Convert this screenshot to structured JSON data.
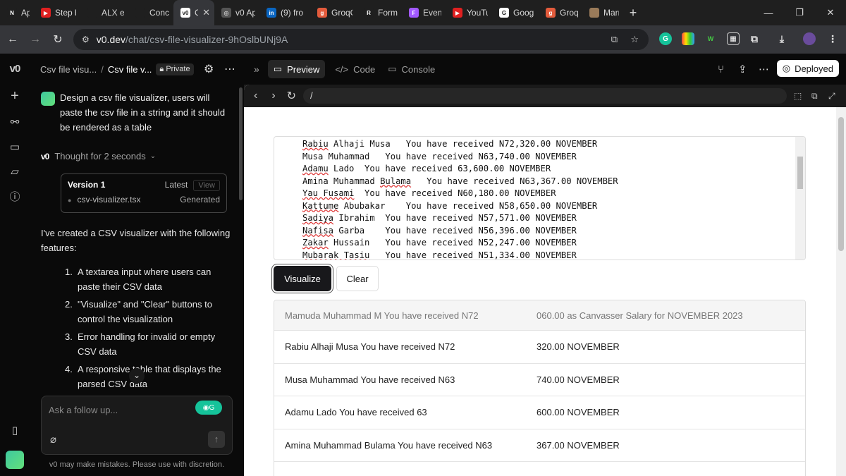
{
  "browser": {
    "tabs": [
      {
        "title": "App R",
        "fav": "N",
        "color": "#1f1f1f"
      },
      {
        "title": "Step b",
        "fav": "▶",
        "color": "#e02020"
      },
      {
        "title": "ALX e",
        "fav": "",
        "color": "#1f1f1f"
      },
      {
        "title": "Conce",
        "fav": "",
        "color": "#1f1f1f"
      },
      {
        "title": "C",
        "fav": "v0",
        "color": "#ffffff",
        "active": true
      },
      {
        "title": "v0 Ap",
        "fav": "◎",
        "color": "#555"
      },
      {
        "title": "(9) fro",
        "fav": "in",
        "color": "#0a66c2"
      },
      {
        "title": "GroqC",
        "fav": "g",
        "color": "#e35b3c"
      },
      {
        "title": "Form",
        "fav": "R",
        "color": "#1f1f1f"
      },
      {
        "title": "Event",
        "fav": "F",
        "color": "#a259ff"
      },
      {
        "title": "YouTu",
        "fav": "▶",
        "color": "#e02020"
      },
      {
        "title": "Googl",
        "fav": "G",
        "color": "#ffffff"
      },
      {
        "title": "GroqC",
        "fav": "g",
        "color": "#e35b3c"
      },
      {
        "title": "Marri",
        "fav": "",
        "color": "#9a7b5a"
      }
    ],
    "url_host": "v0.dev",
    "url_path": "/chat/csv-file-visualizer-9hOslbUNj9A"
  },
  "sidebar": {
    "logo": "v0",
    "crumb_parent": "Csv file visu...",
    "crumb_current": "Csv file v...",
    "privacy": "Private"
  },
  "chat": {
    "user_message": "Design a csv file visualizer, users will paste the csv file in a string and it should be rendered as a table",
    "thought": "Thought for 2 seconds",
    "version_title": "Version 1",
    "version_latest": "Latest",
    "version_view": "View",
    "file_name": "csv-visualizer.tsx",
    "file_status": "Generated",
    "reply_intro": "I've created a CSV visualizer with the following features:",
    "features": [
      {
        "n": "1.",
        "text": "A textarea input where users can paste their CSV data"
      },
      {
        "n": "2.",
        "text": "\"Visualize\" and \"Clear\" buttons to control the visualization"
      },
      {
        "n": "3.",
        "text": "Error handling for invalid or empty CSV data"
      },
      {
        "n": "4.",
        "text": "A responsive table that displays the parsed CSV data"
      }
    ],
    "input_placeholder": "Ask a follow up...",
    "disclaimer": "v0 may make mistakes. Please use with discretion."
  },
  "toolbar": {
    "preview": "Preview",
    "code": "Code",
    "console": "Console",
    "deployed": "Deployed"
  },
  "preview": {
    "path": "/",
    "textarea_lines": [
      [
        "Rabiu",
        " Alhaji Musa   You have received N72,320.00 NOVEMBER"
      ],
      [
        "",
        "Musa Muhammad   You have received N63,740.00 NOVEMBER"
      ],
      [
        "Adamu",
        " Lado  You have received 63,600.00 NOVEMBER"
      ],
      [
        "",
        "Amina Muhammad ",
        "Bulama",
        "   You have received N63,367.00 NOVEMBER"
      ],
      [
        "Yau Fusami",
        "  You have received N60,180.00 NOVEMBER"
      ],
      [
        "Kattume",
        " Abubakar    You have received N58,650.00 NOVEMBER"
      ],
      [
        "Sadiya",
        " Ibrahim  You have received N57,571.00 NOVEMBER"
      ],
      [
        "Nafisa",
        " Garba    You have received N56,396.00 NOVEMBER"
      ],
      [
        "Zakar",
        " Hussain   You have received N52,247.00 NOVEMBER"
      ],
      [
        "Mubarak Tasiu",
        "   You have received N51,334.00 NOVEMBER"
      ]
    ],
    "visualize": "Visualize",
    "clear": "Clear",
    "table_header": [
      "Mamuda Muhammad M You have received N72",
      "060.00 as Canvasser Salary for NOVEMBER 2023"
    ],
    "table_rows": [
      [
        "Rabiu Alhaji Musa You have received N72",
        "320.00 NOVEMBER"
      ],
      [
        "Musa Muhammad You have received N63",
        "740.00 NOVEMBER"
      ],
      [
        "Adamu Lado You have received 63",
        "600.00 NOVEMBER"
      ],
      [
        "Amina Muhammad Bulama You have received N63",
        "367.00 NOVEMBER"
      ],
      [
        "",
        ""
      ]
    ]
  }
}
